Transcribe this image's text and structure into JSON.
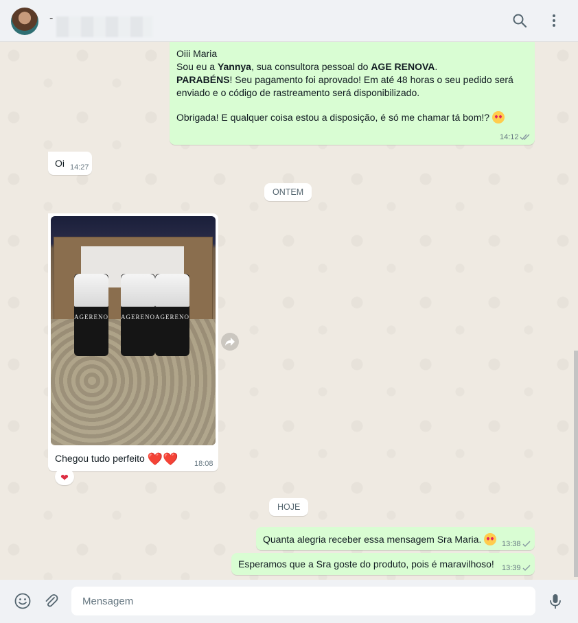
{
  "header": {
    "contact_dash": "-",
    "contact_name": "",
    "icons": [
      "search-icon",
      "more-options-icon"
    ]
  },
  "messages": {
    "m1": {
      "direction": "outgoing",
      "line1": "Oiii Maria",
      "line2_pre": "Sou eu a ",
      "line2_bold": "Yannya",
      "line2_mid": ", sua consultora pessoal do ",
      "line2_bold2": "AGE RENOVA",
      "line2_end": ".",
      "line3_bold": "PARABÉNS",
      "line3_rest": "! Seu pagamento foi aprovado! Em até 48 horas o seu pedido será",
      "line4": "enviado e o código de rastreamento será disponibilizado.",
      "line5": "Obrigada! E qualquer coisa estou a disposição, é só me chamar tá bom!?",
      "time": "14:12",
      "status": "read"
    },
    "m2": {
      "direction": "incoming",
      "text": "Oi",
      "time": "14:27"
    },
    "divider1": "ONTEM",
    "m3": {
      "direction": "incoming",
      "image_text": "AGERENOVA",
      "caption": "Chegou tudo perfeito",
      "time": "18:08",
      "reaction": "heart"
    },
    "divider2": "HOJE",
    "m4": {
      "direction": "outgoing",
      "text": "Quanta alegria receber essa mensagem Sra Maria.",
      "time": "13:38",
      "status": "sent"
    },
    "m5": {
      "direction": "outgoing",
      "text": "Esperamos que a Sra goste do produto, pois é maravilhoso!",
      "time": "13:39",
      "status": "sent"
    }
  },
  "composer": {
    "placeholder": "Mensagem",
    "icons": [
      "emoji-icon",
      "attach-icon",
      "microphone-icon"
    ]
  },
  "colors": {
    "outgoing_bubble": "#d9fdd3",
    "incoming_bubble": "#ffffff",
    "chat_background": "#efeae2",
    "bar_background": "#f0f2f5"
  }
}
